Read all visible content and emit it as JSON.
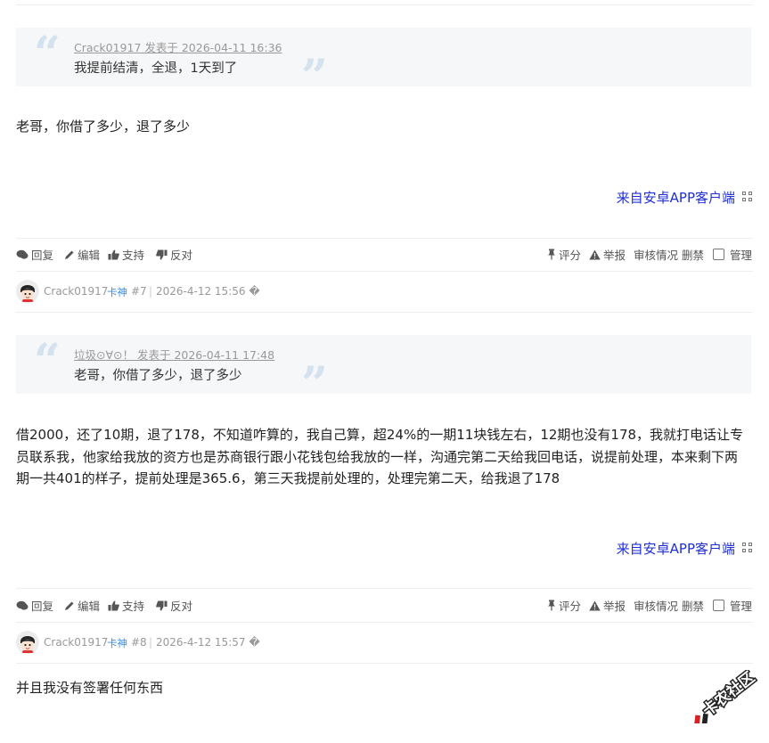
{
  "posts": [
    {
      "quote": {
        "author_line": "Crack01917 发表于 2026-04-11 16:36",
        "text": "我提前结清，全退，1天到了"
      },
      "body": "老哥，你借了多少，退了多少",
      "from_app": "来自安卓APP客户端",
      "actions": {
        "reply": "回复",
        "edit": "编辑",
        "support": "支持",
        "oppose": "反对",
        "rate": "评分",
        "report": "举报",
        "review": "审核情况",
        "ban": "删禁",
        "manage": "管理"
      }
    },
    {
      "meta": {
        "author": "Crack01917",
        "rank": "卡神",
        "floor": "#7",
        "time": "2026-4-12 15:56 �"
      },
      "quote": {
        "author_line": "垃圾⊙∀⊙！ 发表于 2026-04-11 17:48",
        "text": "老哥，你借了多少，退了多少"
      },
      "body": "借2000，还了10期，退了178，不知道咋算的，我自己算，超24%的一期11块钱左右，12期也没有178，我就打电话让专员联系我，他家给我放的资方也是苏商银行跟小花钱包给我放的一样，沟通完第二天给我回电话，说提前处理，本来剩下两期一共401的样子，提前处理是365.6，第三天我提前处理的，处理完第二天，给我退了178",
      "from_app": "来自安卓APP客户端",
      "actions": {
        "reply": "回复",
        "edit": "编辑",
        "support": "支持",
        "oppose": "反对",
        "rate": "评分",
        "report": "举报",
        "review": "审核情况",
        "ban": "删禁",
        "manage": "管理"
      }
    },
    {
      "meta": {
        "author": "Crack01917",
        "rank": "卡神",
        "floor": "#8",
        "time": "2026-4-12 15:57 �"
      },
      "body": "并且我没有签署任何东西"
    }
  ],
  "watermark": "卡农社区",
  "colors": {
    "link_blue": "#1f2fd6",
    "rank_blue": "#3a8ee6",
    "quote_bg": "#f6f7f8",
    "quote_mark": "#d3e2ee"
  }
}
